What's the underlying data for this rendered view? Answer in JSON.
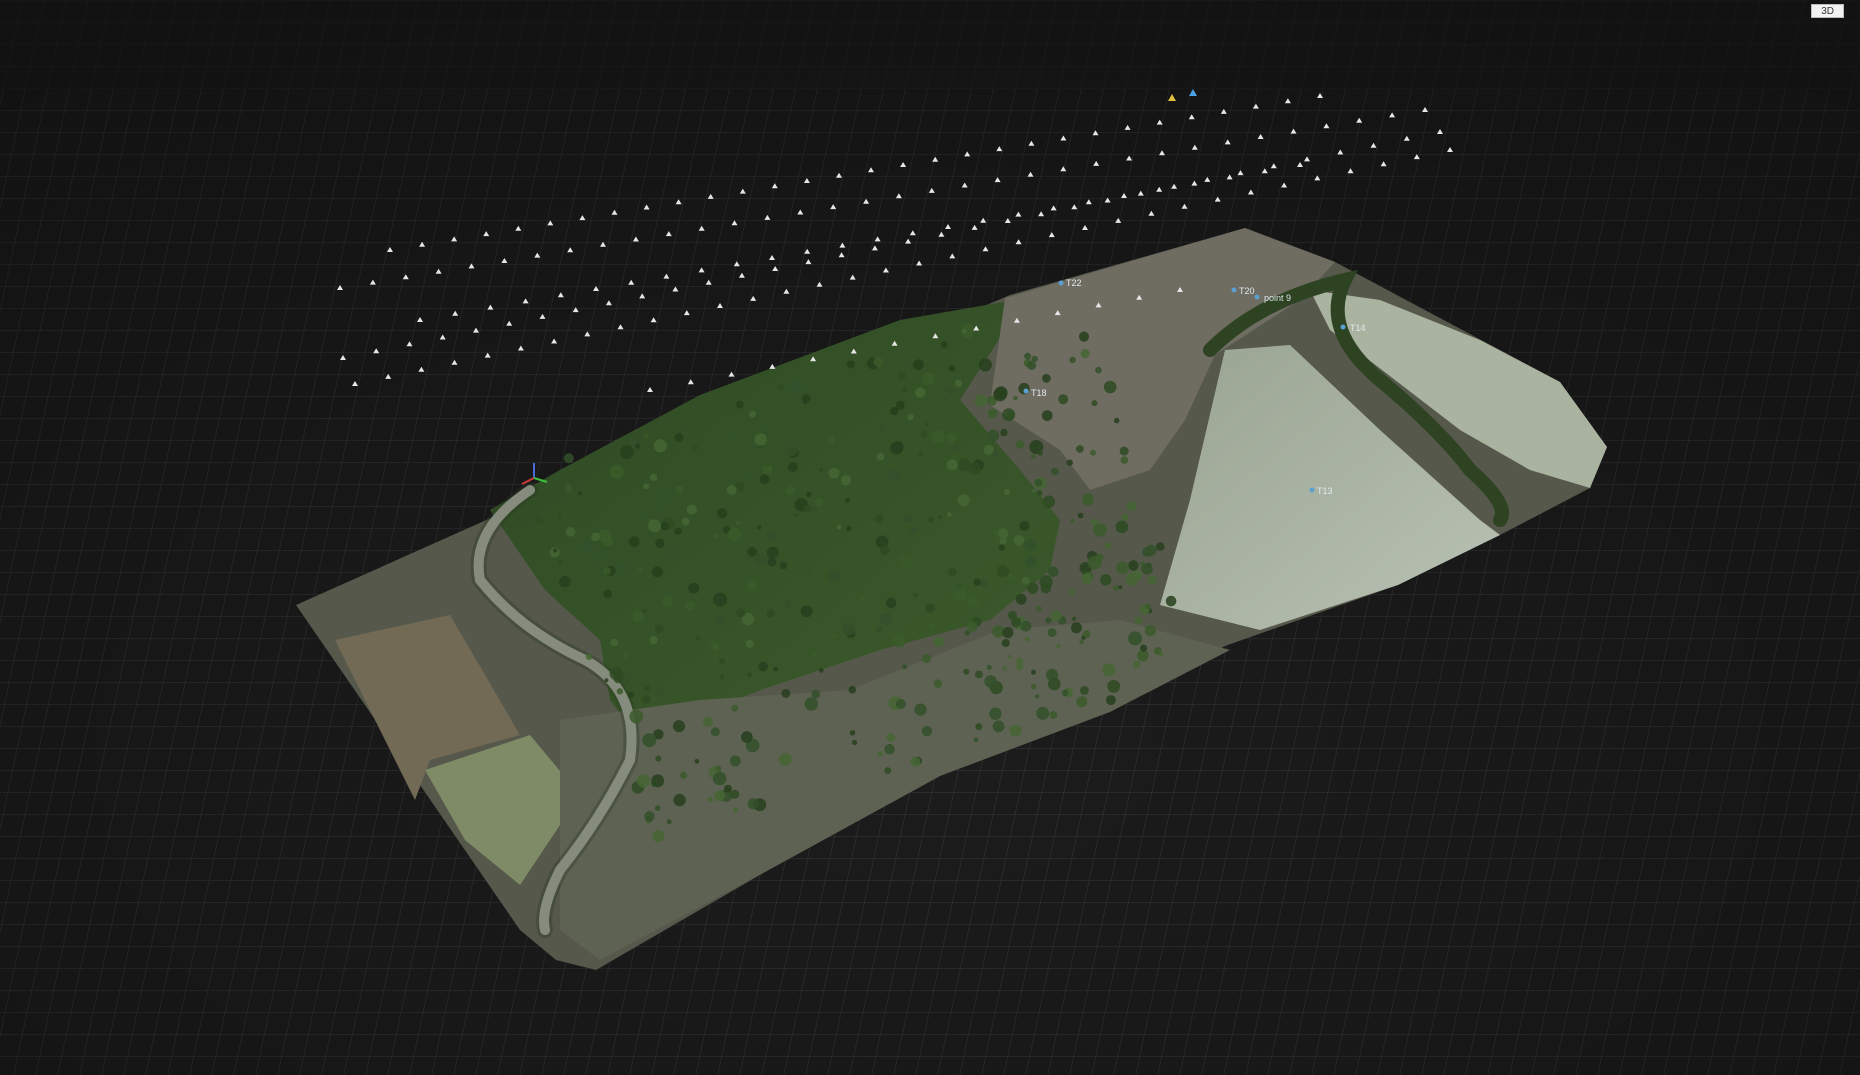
{
  "viewport": {
    "view_mode_label": "3D",
    "background_color": "#1c1c1c",
    "grid_color": "#3c3c3c"
  },
  "gcp_labels": {
    "t22": "T22",
    "t20": "T20",
    "point9": "point 9",
    "t18": "T18",
    "t13": "T13",
    "t14": "T14"
  },
  "colors": {
    "camera_marker": "#e6e6e6",
    "gcp_marker": "#5aa0d0",
    "axis_x": "#d03a3a",
    "axis_y": "#3ac03a",
    "axis_z": "#4a6ad8"
  }
}
